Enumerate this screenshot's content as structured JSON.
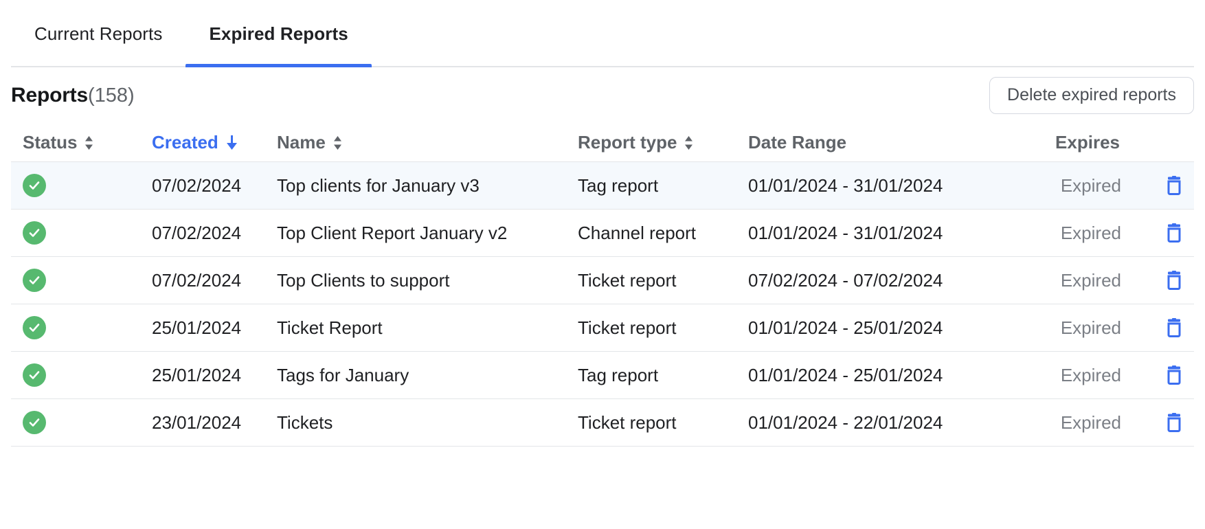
{
  "tabs": [
    {
      "label": "Current Reports",
      "active": false
    },
    {
      "label": "Expired Reports",
      "active": true
    }
  ],
  "section": {
    "title": "Reports",
    "count": "(158)",
    "delete_button": "Delete expired reports"
  },
  "table": {
    "columns": [
      {
        "label": "Status",
        "sortable": true,
        "sorted": false,
        "direction": ""
      },
      {
        "label": "Created",
        "sortable": true,
        "sorted": true,
        "direction": "desc"
      },
      {
        "label": "Name",
        "sortable": true,
        "sorted": false,
        "direction": ""
      },
      {
        "label": "Report type",
        "sortable": true,
        "sorted": false,
        "direction": ""
      },
      {
        "label": "Date Range",
        "sortable": false,
        "sorted": false,
        "direction": ""
      },
      {
        "label": "Expires",
        "sortable": false,
        "sorted": false,
        "direction": ""
      }
    ],
    "rows": [
      {
        "status": "complete",
        "created": "07/02/2024",
        "name": "Top clients for January v3",
        "type": "Tag report",
        "range": "01/01/2024 - 31/01/2024",
        "expires": "Expired",
        "hovered": true
      },
      {
        "status": "complete",
        "created": "07/02/2024",
        "name": "Top Client Report January v2",
        "type": "Channel report",
        "range": "01/01/2024 - 31/01/2024",
        "expires": "Expired",
        "hovered": false
      },
      {
        "status": "complete",
        "created": "07/02/2024",
        "name": "Top Clients to support",
        "type": "Ticket report",
        "range": "07/02/2024 - 07/02/2024",
        "expires": "Expired",
        "hovered": false
      },
      {
        "status": "complete",
        "created": "25/01/2024",
        "name": "Ticket Report",
        "type": "Ticket report",
        "range": "01/01/2024 - 25/01/2024",
        "expires": "Expired",
        "hovered": false
      },
      {
        "status": "complete",
        "created": "25/01/2024",
        "name": "Tags for January",
        "type": "Tag report",
        "range": "01/01/2024 - 25/01/2024",
        "expires": "Expired",
        "hovered": false
      },
      {
        "status": "complete",
        "created": "23/01/2024",
        "name": "Tickets",
        "type": "Ticket report",
        "range": "01/01/2024 - 22/01/2024",
        "expires": "Expired",
        "hovered": false
      }
    ]
  },
  "icons": {
    "status": "check-circle-icon",
    "delete_row": "trash-icon",
    "sort_both": "sort-arrows-icon",
    "sort_desc": "arrow-down-icon"
  },
  "colors": {
    "accent": "#3b6ef0",
    "status_green": "#57b96f",
    "text_primary": "#1f2023",
    "text_muted": "#7b7f86",
    "header_text": "#5f6368",
    "border": "#e3e5e8",
    "row_hover": "#f5f9fd"
  }
}
